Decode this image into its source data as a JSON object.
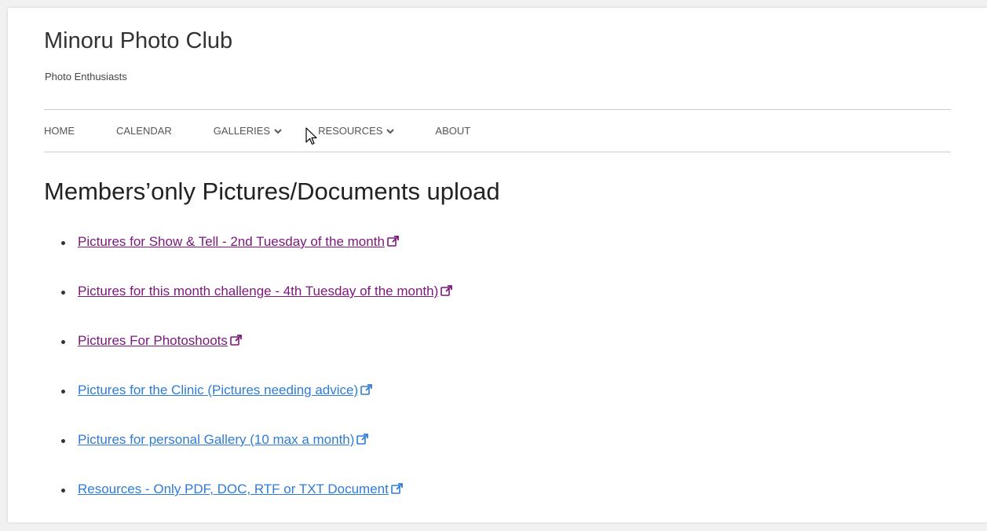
{
  "site": {
    "title": "Minoru Photo Club",
    "tagline": "Photo Enthusiasts"
  },
  "nav": {
    "items": [
      {
        "label": "HOME",
        "has_dropdown": false
      },
      {
        "label": "CALENDAR",
        "has_dropdown": false
      },
      {
        "label": "GALLERIES",
        "has_dropdown": true
      },
      {
        "label": "RESOURCES",
        "has_dropdown": true
      },
      {
        "label": "ABOUT",
        "has_dropdown": false
      }
    ]
  },
  "main": {
    "heading": "Members’only Pictures/Documents upload",
    "links": [
      {
        "label": "Pictures for Show & Tell - 2nd Tuesday of the month",
        "visited": true,
        "icon": "external-link-icon"
      },
      {
        "label": "Pictures for this month challenge - 4th Tuesday of the month)",
        "visited": true,
        "icon": "external-link-icon"
      },
      {
        "label": "Pictures For Photoshoots",
        "visited": true,
        "icon": "external-link-icon"
      },
      {
        "label": "Pictures for the Clinic (Pictures needing advice)",
        "visited": false,
        "icon": "external-link-icon"
      },
      {
        "label": "Pictures for personal Gallery (10 max a month)",
        "visited": false,
        "icon": "external-link-icon"
      },
      {
        "label": "Resources - Only PDF, DOC, RTF or TXT Document",
        "visited": false,
        "icon": "external-link-icon"
      }
    ]
  },
  "colors": {
    "visited_link": "#7b177b",
    "link": "#2f7bd8",
    "text": "#333333",
    "rule": "#cccccc"
  }
}
